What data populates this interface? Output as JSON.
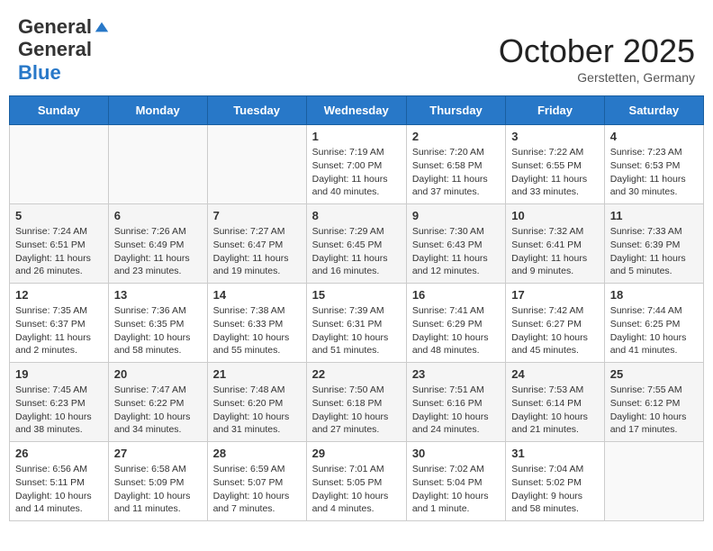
{
  "header": {
    "logo_general": "General",
    "logo_blue": "Blue",
    "month_title": "October 2025",
    "location": "Gerstetten, Germany"
  },
  "weekdays": [
    "Sunday",
    "Monday",
    "Tuesday",
    "Wednesday",
    "Thursday",
    "Friday",
    "Saturday"
  ],
  "weeks": [
    [
      {
        "day": "",
        "info": ""
      },
      {
        "day": "",
        "info": ""
      },
      {
        "day": "",
        "info": ""
      },
      {
        "day": "1",
        "info": "Sunrise: 7:19 AM\nSunset: 7:00 PM\nDaylight: 11 hours and 40 minutes."
      },
      {
        "day": "2",
        "info": "Sunrise: 7:20 AM\nSunset: 6:58 PM\nDaylight: 11 hours and 37 minutes."
      },
      {
        "day": "3",
        "info": "Sunrise: 7:22 AM\nSunset: 6:55 PM\nDaylight: 11 hours and 33 minutes."
      },
      {
        "day": "4",
        "info": "Sunrise: 7:23 AM\nSunset: 6:53 PM\nDaylight: 11 hours and 30 minutes."
      }
    ],
    [
      {
        "day": "5",
        "info": "Sunrise: 7:24 AM\nSunset: 6:51 PM\nDaylight: 11 hours and 26 minutes."
      },
      {
        "day": "6",
        "info": "Sunrise: 7:26 AM\nSunset: 6:49 PM\nDaylight: 11 hours and 23 minutes."
      },
      {
        "day": "7",
        "info": "Sunrise: 7:27 AM\nSunset: 6:47 PM\nDaylight: 11 hours and 19 minutes."
      },
      {
        "day": "8",
        "info": "Sunrise: 7:29 AM\nSunset: 6:45 PM\nDaylight: 11 hours and 16 minutes."
      },
      {
        "day": "9",
        "info": "Sunrise: 7:30 AM\nSunset: 6:43 PM\nDaylight: 11 hours and 12 minutes."
      },
      {
        "day": "10",
        "info": "Sunrise: 7:32 AM\nSunset: 6:41 PM\nDaylight: 11 hours and 9 minutes."
      },
      {
        "day": "11",
        "info": "Sunrise: 7:33 AM\nSunset: 6:39 PM\nDaylight: 11 hours and 5 minutes."
      }
    ],
    [
      {
        "day": "12",
        "info": "Sunrise: 7:35 AM\nSunset: 6:37 PM\nDaylight: 11 hours and 2 minutes."
      },
      {
        "day": "13",
        "info": "Sunrise: 7:36 AM\nSunset: 6:35 PM\nDaylight: 10 hours and 58 minutes."
      },
      {
        "day": "14",
        "info": "Sunrise: 7:38 AM\nSunset: 6:33 PM\nDaylight: 10 hours and 55 minutes."
      },
      {
        "day": "15",
        "info": "Sunrise: 7:39 AM\nSunset: 6:31 PM\nDaylight: 10 hours and 51 minutes."
      },
      {
        "day": "16",
        "info": "Sunrise: 7:41 AM\nSunset: 6:29 PM\nDaylight: 10 hours and 48 minutes."
      },
      {
        "day": "17",
        "info": "Sunrise: 7:42 AM\nSunset: 6:27 PM\nDaylight: 10 hours and 45 minutes."
      },
      {
        "day": "18",
        "info": "Sunrise: 7:44 AM\nSunset: 6:25 PM\nDaylight: 10 hours and 41 minutes."
      }
    ],
    [
      {
        "day": "19",
        "info": "Sunrise: 7:45 AM\nSunset: 6:23 PM\nDaylight: 10 hours and 38 minutes."
      },
      {
        "day": "20",
        "info": "Sunrise: 7:47 AM\nSunset: 6:22 PM\nDaylight: 10 hours and 34 minutes."
      },
      {
        "day": "21",
        "info": "Sunrise: 7:48 AM\nSunset: 6:20 PM\nDaylight: 10 hours and 31 minutes."
      },
      {
        "day": "22",
        "info": "Sunrise: 7:50 AM\nSunset: 6:18 PM\nDaylight: 10 hours and 27 minutes."
      },
      {
        "day": "23",
        "info": "Sunrise: 7:51 AM\nSunset: 6:16 PM\nDaylight: 10 hours and 24 minutes."
      },
      {
        "day": "24",
        "info": "Sunrise: 7:53 AM\nSunset: 6:14 PM\nDaylight: 10 hours and 21 minutes."
      },
      {
        "day": "25",
        "info": "Sunrise: 7:55 AM\nSunset: 6:12 PM\nDaylight: 10 hours and 17 minutes."
      }
    ],
    [
      {
        "day": "26",
        "info": "Sunrise: 6:56 AM\nSunset: 5:11 PM\nDaylight: 10 hours and 14 minutes."
      },
      {
        "day": "27",
        "info": "Sunrise: 6:58 AM\nSunset: 5:09 PM\nDaylight: 10 hours and 11 minutes."
      },
      {
        "day": "28",
        "info": "Sunrise: 6:59 AM\nSunset: 5:07 PM\nDaylight: 10 hours and 7 minutes."
      },
      {
        "day": "29",
        "info": "Sunrise: 7:01 AM\nSunset: 5:05 PM\nDaylight: 10 hours and 4 minutes."
      },
      {
        "day": "30",
        "info": "Sunrise: 7:02 AM\nSunset: 5:04 PM\nDaylight: 10 hours and 1 minute."
      },
      {
        "day": "31",
        "info": "Sunrise: 7:04 AM\nSunset: 5:02 PM\nDaylight: 9 hours and 58 minutes."
      },
      {
        "day": "",
        "info": ""
      }
    ]
  ]
}
